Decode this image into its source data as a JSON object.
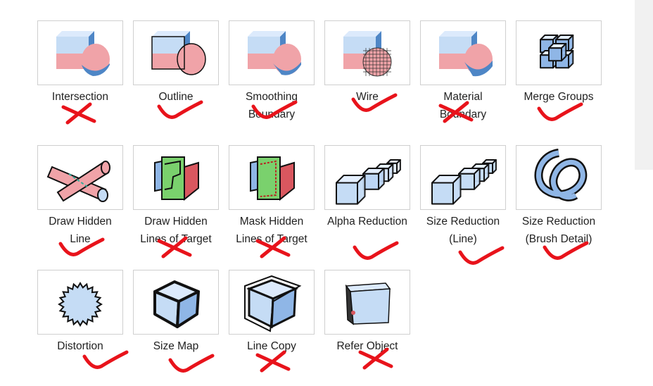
{
  "colors": {
    "border": "#cfcfcf",
    "text": "#222222",
    "annotation": "#e8131b",
    "cube_face_light": "#c5dcf5",
    "cube_face_mid": "#8fb6e6",
    "cube_face_dark": "#4e86c6",
    "pink": "#f0a3a8",
    "red": "#d9575f",
    "green": "#7ad16d",
    "scrollbar_track": "#f1f1f1"
  },
  "tiles": [
    {
      "lines": [
        "Intersection"
      ],
      "icon": "intersection-icon",
      "mark": "cross"
    },
    {
      "lines": [
        "Outline"
      ],
      "icon": "outline-icon",
      "mark": "check"
    },
    {
      "lines": [
        "Smoothing",
        "Boundary"
      ],
      "icon": "smoothing-boundary-icon",
      "mark": "check"
    },
    {
      "lines": [
        "Wire"
      ],
      "icon": "wire-icon",
      "mark": "check"
    },
    {
      "lines": [
        "Material",
        "Boundary"
      ],
      "icon": "material-boundary-icon",
      "mark": "cross"
    },
    {
      "lines": [
        "Merge Groups"
      ],
      "icon": "merge-groups-icon",
      "mark": "check"
    },
    {
      "lines": [
        "Draw Hidden",
        "Line"
      ],
      "icon": "draw-hidden-line-icon",
      "mark": "check"
    },
    {
      "lines": [
        "Draw Hidden",
        "Lines of Target"
      ],
      "icon": "draw-hidden-lines-of-target-icon",
      "mark": "cross"
    },
    {
      "lines": [
        "Mask Hidden",
        "Lines of Target"
      ],
      "icon": "mask-hidden-lines-of-target-icon",
      "mark": "cross"
    },
    {
      "lines": [
        "Alpha Reduction"
      ],
      "icon": "alpha-reduction-icon",
      "mark": "check"
    },
    {
      "lines": [
        "Size Reduction",
        "(Line)"
      ],
      "icon": "size-reduction-line-icon",
      "mark": "check"
    },
    {
      "lines": [
        "Size Reduction",
        "(Brush Detail)"
      ],
      "icon": "size-reduction-brush-detail-icon",
      "mark": "check"
    },
    {
      "lines": [
        "Distortion"
      ],
      "icon": "distortion-icon",
      "mark": "check"
    },
    {
      "lines": [
        "Size Map"
      ],
      "icon": "size-map-icon",
      "mark": "check"
    },
    {
      "lines": [
        "Line Copy"
      ],
      "icon": "line-copy-icon",
      "mark": "cross"
    },
    {
      "lines": [
        "Refer Object"
      ],
      "icon": "refer-object-icon",
      "mark": "cross"
    }
  ]
}
